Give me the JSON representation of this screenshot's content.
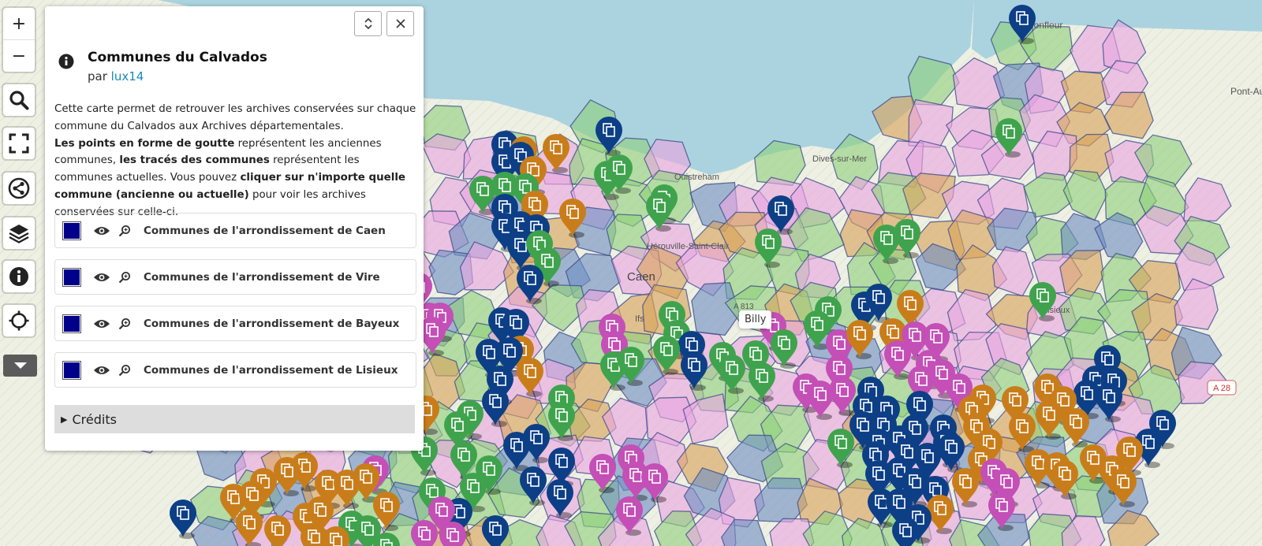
{
  "colors": {
    "sea": "#aad3df",
    "land": "#eef0e4",
    "accent_link": "#1a8ab8",
    "marker_blue": "#0d3f87",
    "marker_green": "#3fa34d",
    "marker_orange": "#c97d1a",
    "marker_pink": "#c44fb6",
    "layer_swatch": "#00008b"
  },
  "controls": {
    "zoom_in": "+",
    "zoom_out": "−",
    "icons": [
      "search-icon",
      "fullscreen-icon",
      "share-icon",
      "layers-icon",
      "info-icon",
      "locate-icon"
    ]
  },
  "panel": {
    "title": "Communes du Calvados",
    "by_prefix": "par ",
    "author": "lux14",
    "desc": {
      "p1": "Cette carte permet de retrouver les archives conservées sur chaque commune du Calvados aux Archives départementales.",
      "b1": "Les points en forme de goutte",
      "t1": " représentent les anciennes communes, ",
      "b2": "les tracés des communes",
      "t2": " représentent les communes actuelles. Vous pouvez ",
      "b3": "cliquer sur n'importe quelle commune (ancienne ou actuelle)",
      "t3": " pour voir les archives conservées sur celle-ci."
    },
    "layers": [
      {
        "name": "Communes de l'arrondissement de Caen"
      },
      {
        "name": "Communes de l'arrondissement de Vire"
      },
      {
        "name": "Communes de l'arrondissement de Bayeux"
      },
      {
        "name": "Communes de l'arrondissement de Lisieux"
      }
    ],
    "credits": "Crédits"
  },
  "map_labels": {
    "honfleur": "Honfleur",
    "pont_au": "Pont-Au",
    "dives": "Dives-sur-Mer",
    "ouistreham": "Ouistreham",
    "herouville": "Hérouville-Saint-Clair",
    "caen": "Caen",
    "ifs": "Ifs",
    "lisieux": "Lisieux",
    "a28": "A 28",
    "a813": "A 813"
  },
  "tooltip": "Billy"
}
